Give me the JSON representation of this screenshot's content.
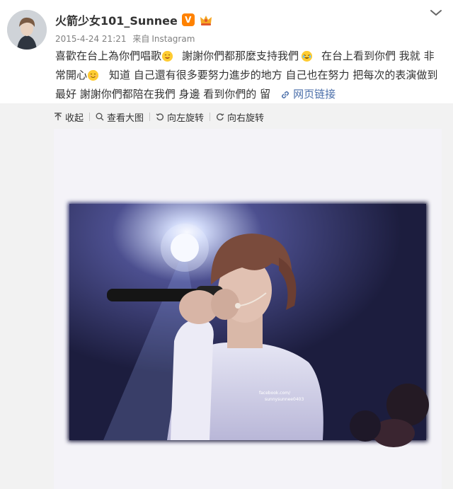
{
  "post": {
    "username": "火箭少女101_Sunnee",
    "verified_badge": "V",
    "timestamp": "2015-4-24 21:21",
    "source_prefix": "来自",
    "source": "Instagram",
    "text_lines": [
      [
        "喜歡在台上為你們唱歌",
        "謝謝你們都那麼支持我們",
        "在台上看到你們 我就 非"
      ],
      [
        "常開心",
        "知道 自己還有很多要努力進步的地方 自己也在努力 把每次的表演做到"
      ],
      [
        "最好 謝謝你們都陪在我們 身邊  看到你們的 留"
      ]
    ],
    "web_link_label": "网页链接"
  },
  "toolbar": {
    "collapse": "收起",
    "view_large": "查看大图",
    "rotate_left": "向左旋转",
    "rotate_right": "向右旋转"
  },
  "photo": {
    "watermark_line1": "facebook.com/",
    "watermark_line2": "sunnysunnee0403"
  },
  "icons": {
    "avatar": "user-avatar",
    "dropdown": "chevron-down-icon",
    "crown": "crown-badge-icon",
    "link": "link-icon",
    "collapse": "arrow-up-icon",
    "zoom": "search-icon",
    "rotate_left": "rotate-left-icon",
    "rotate_right": "rotate-right-icon"
  },
  "colors": {
    "link": "#4a6ea9",
    "badge_orange": "#ff8200",
    "meta_gray": "#808080",
    "media_bg": "#f2f2f2"
  }
}
